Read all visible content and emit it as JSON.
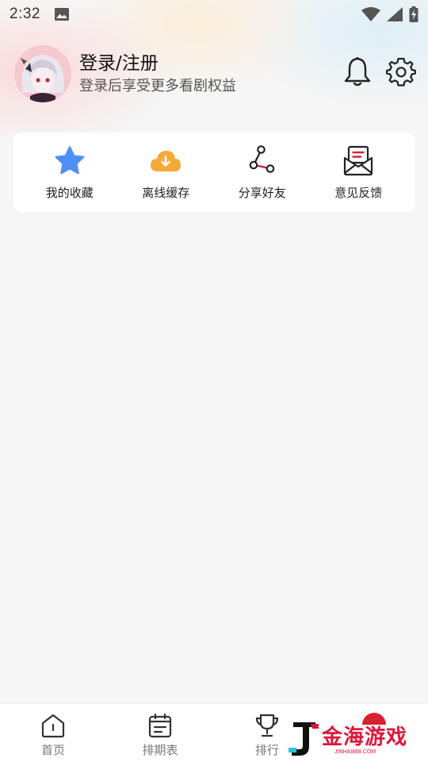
{
  "status_bar": {
    "time": "2:32",
    "icons": [
      "image-icon",
      "wifi-icon",
      "signal-icon",
      "battery-charging-icon"
    ]
  },
  "profile": {
    "title": "登录/注册",
    "subtitle": "登录后享受更多看剧权益",
    "avatar_icon": "avatar"
  },
  "header_actions": {
    "icons": [
      "bell-icon",
      "gear-icon"
    ]
  },
  "quick_actions": [
    {
      "label": "我的收藏",
      "icon": "star-icon",
      "color": "#4f8ef7"
    },
    {
      "label": "离线缓存",
      "icon": "cloud-download-icon",
      "color": "#f5a93a"
    },
    {
      "label": "分享好友",
      "icon": "share-icon",
      "color": "#d0233a"
    },
    {
      "label": "意见反馈",
      "icon": "mail-feedback-icon",
      "color": "#d0233a"
    }
  ],
  "bottom_nav": [
    {
      "label": "首页",
      "icon": "home-icon"
    },
    {
      "label": "排期表",
      "icon": "calendar-icon"
    },
    {
      "label": "排行",
      "icon": "trophy-icon"
    }
  ],
  "watermark": {
    "text": "金海游戏",
    "sub": "JINHAI888.COM"
  },
  "colors": {
    "accent_red": "#d0233a",
    "star_blue": "#4f8ef7",
    "cloud_orange": "#f5a93a",
    "background": "#f6f6f6"
  }
}
